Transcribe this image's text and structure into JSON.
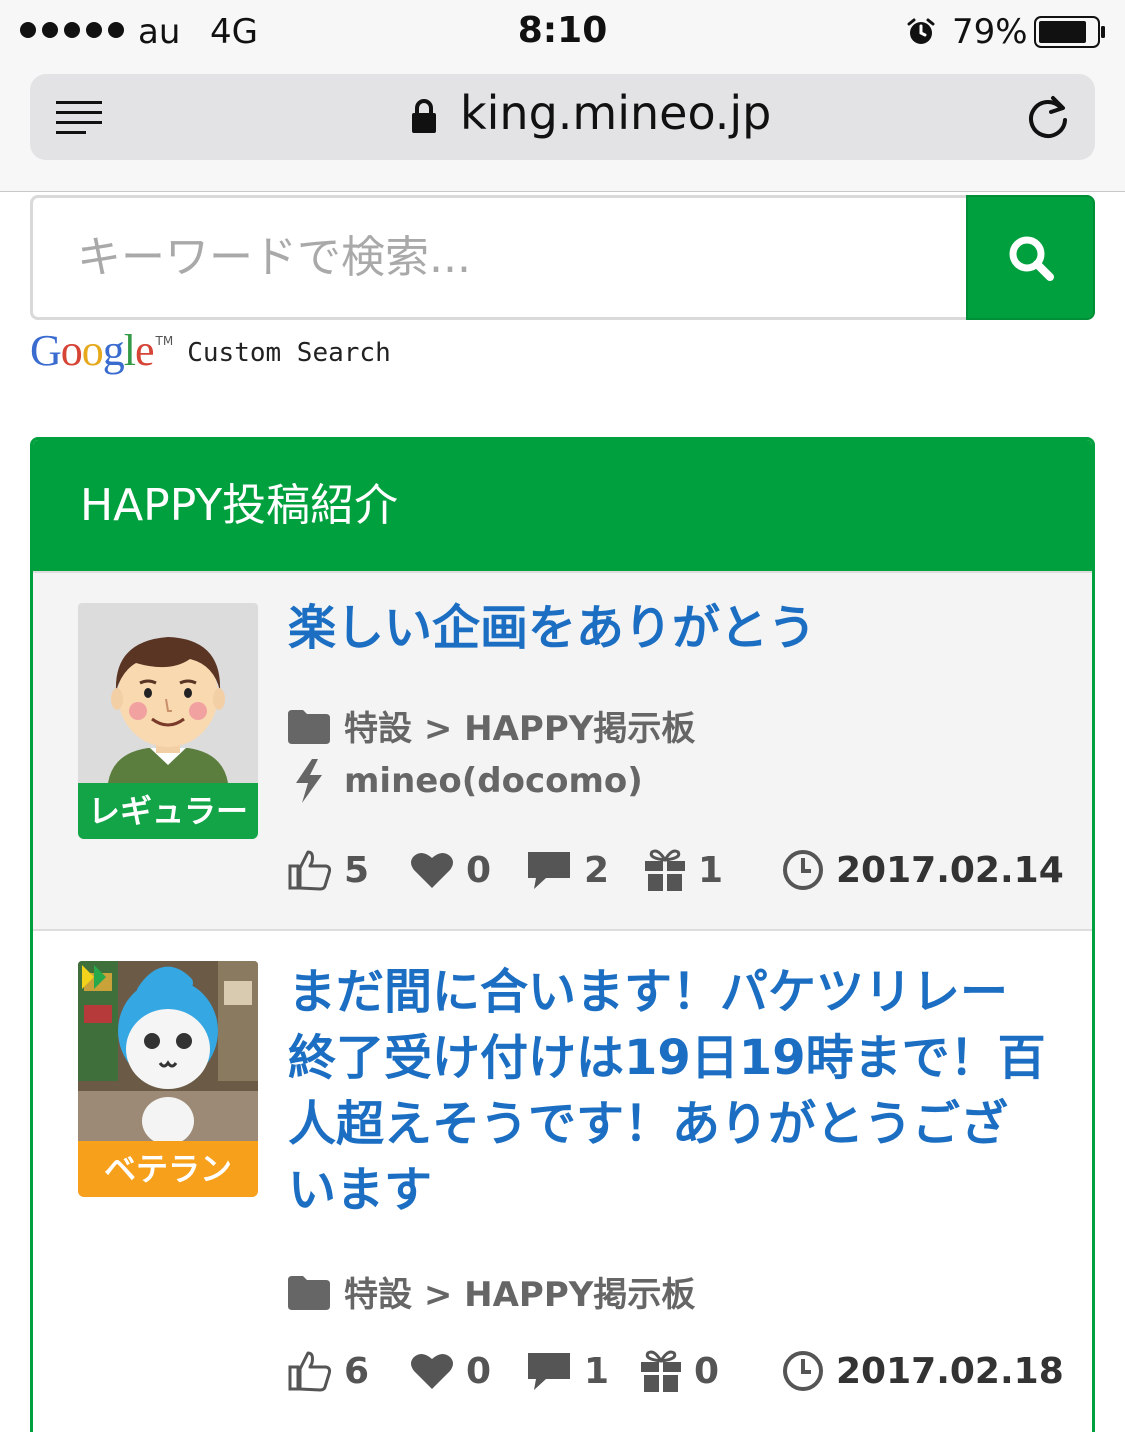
{
  "status_bar": {
    "carrier": "au",
    "network": "4G",
    "time": "8:10",
    "battery": "79%"
  },
  "browser": {
    "url": "king.mineo.jp"
  },
  "search": {
    "placeholder": "キーワードで検索...",
    "brand_logo": "Google",
    "brand_tm": "TM",
    "brand_suffix": "Custom Search"
  },
  "panel": {
    "title": "HAPPY投稿紹介",
    "posts": [
      {
        "title": "楽しい企画をありがとう",
        "rank": "レギュラー",
        "category": "特設 > HAPPY掲示板",
        "carrier": "mineo(docomo)",
        "likes": "5",
        "hearts": "0",
        "comments": "2",
        "gifts": "1",
        "date": "2017.02.14"
      },
      {
        "title": "まだ間に合います！パケツリレー終了受け付けは19日19時まで！百人超えそうです！ありがとうございます",
        "rank": "ベテラン",
        "category": "特設 > HAPPY掲示板",
        "likes": "6",
        "hearts": "0",
        "comments": "1",
        "gifts": "0",
        "date": "2017.02.18"
      }
    ]
  },
  "colors": {
    "brand_green": "#00a03e",
    "link_blue": "#1b6ec2",
    "badge_regular": "#12a447",
    "badge_veteran": "#f7a01b"
  },
  "icons": [
    "signal-icon",
    "alarm-icon",
    "battery-icon",
    "reader-icon",
    "lock-icon",
    "reload-icon",
    "search-icon",
    "folder-icon",
    "lightning-icon",
    "thumbs-up-icon",
    "heart-icon",
    "comment-icon",
    "gift-icon",
    "clock-icon"
  ]
}
